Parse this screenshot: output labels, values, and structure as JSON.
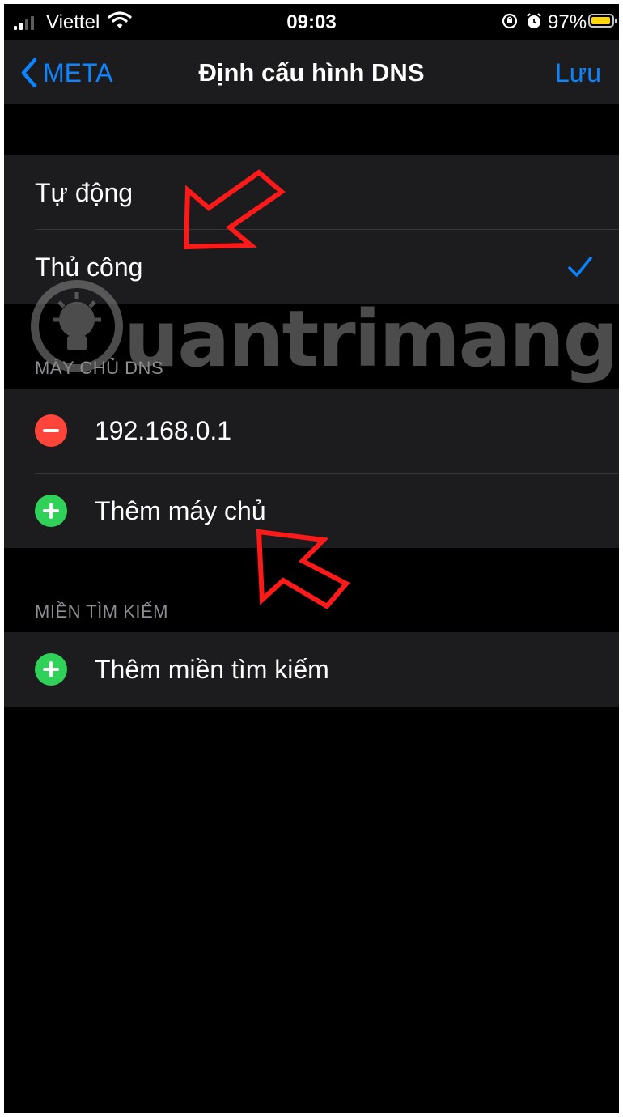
{
  "status_bar": {
    "carrier": "Viettel",
    "time": "09:03",
    "battery_percent": "97%",
    "battery_level": 0.97,
    "battery_color": "#ffd60a"
  },
  "nav": {
    "back_label": "META",
    "title": "Định cấu hình DNS",
    "save_label": "Lưu",
    "accent_color": "#0a84ff"
  },
  "mode_options": [
    {
      "label": "Tự động",
      "selected": false
    },
    {
      "label": "Thủ công",
      "selected": true
    }
  ],
  "dns_section": {
    "header": "MÁY CHỦ DNS",
    "servers": [
      "192.168.0.1"
    ],
    "add_label": "Thêm máy chủ"
  },
  "search_section": {
    "header": "MIỀN TÌM KIẾM",
    "add_label": "Thêm miền tìm kiếm"
  },
  "watermark": {
    "text": "uantrimang"
  },
  "icons": [
    "signal-icon",
    "wifi-icon",
    "lock-rotation-icon",
    "alarm-icon",
    "battery-icon",
    "chevron-left-icon",
    "checkmark-icon",
    "minus-circle-icon",
    "plus-circle-icon",
    "arrow-annotation-icon",
    "lightbulb-logo-icon"
  ]
}
